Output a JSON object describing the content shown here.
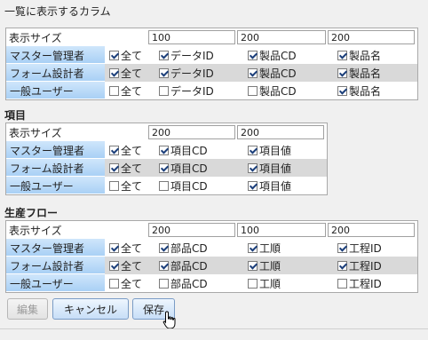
{
  "page_title": "一覧に表示するカラム",
  "sections": [
    {
      "title": "",
      "size_label": "表示サイズ",
      "sizes": [
        "100",
        "200",
        "200"
      ],
      "rows": [
        {
          "role": "マスター管理者",
          "all": {
            "label": "全て",
            "checked": true
          },
          "cols": [
            {
              "label": "データID",
              "checked": true
            },
            {
              "label": "製品CD",
              "checked": true
            },
            {
              "label": "製品名",
              "checked": true
            }
          ]
        },
        {
          "role": "フォーム設計者",
          "all": {
            "label": "全て",
            "checked": true
          },
          "cols": [
            {
              "label": "データID",
              "checked": true
            },
            {
              "label": "製品CD",
              "checked": true
            },
            {
              "label": "製品名",
              "checked": true
            }
          ]
        },
        {
          "role": "一般ユーザー",
          "all": {
            "label": "全て",
            "checked": false
          },
          "cols": [
            {
              "label": "データID",
              "checked": false
            },
            {
              "label": "製品CD",
              "checked": false
            },
            {
              "label": "製品名",
              "checked": true
            }
          ]
        }
      ]
    },
    {
      "title": "項目",
      "size_label": "表示サイズ",
      "sizes": [
        "200",
        "200"
      ],
      "rows": [
        {
          "role": "マスター管理者",
          "all": {
            "label": "全て",
            "checked": true
          },
          "cols": [
            {
              "label": "項目CD",
              "checked": true
            },
            {
              "label": "項目値",
              "checked": true
            }
          ]
        },
        {
          "role": "フォーム設計者",
          "all": {
            "label": "全て",
            "checked": true
          },
          "cols": [
            {
              "label": "項目CD",
              "checked": true
            },
            {
              "label": "項目値",
              "checked": true
            }
          ]
        },
        {
          "role": "一般ユーザー",
          "all": {
            "label": "全て",
            "checked": false
          },
          "cols": [
            {
              "label": "項目CD",
              "checked": false
            },
            {
              "label": "項目値",
              "checked": true
            }
          ]
        }
      ]
    },
    {
      "title": "生産フロー",
      "size_label": "表示サイズ",
      "sizes": [
        "200",
        "100",
        "200"
      ],
      "rows": [
        {
          "role": "マスター管理者",
          "all": {
            "label": "全て",
            "checked": true
          },
          "cols": [
            {
              "label": "部品CD",
              "checked": true
            },
            {
              "label": "工順",
              "checked": true
            },
            {
              "label": "工程ID",
              "checked": true
            }
          ]
        },
        {
          "role": "フォーム設計者",
          "all": {
            "label": "全て",
            "checked": true
          },
          "cols": [
            {
              "label": "部品CD",
              "checked": true
            },
            {
              "label": "工順",
              "checked": true
            },
            {
              "label": "工程ID",
              "checked": true
            }
          ]
        },
        {
          "role": "一般ユーザー",
          "all": {
            "label": "全て",
            "checked": false
          },
          "cols": [
            {
              "label": "部品CD",
              "checked": false
            },
            {
              "label": "工順",
              "checked": false
            },
            {
              "label": "工程ID",
              "checked": false
            }
          ]
        }
      ]
    }
  ],
  "buttons": {
    "edit": "編集",
    "cancel": "キャンセル",
    "save": "保存",
    "edit_disabled": true
  },
  "icons": {
    "cursor": "hand-pointer-icon"
  }
}
